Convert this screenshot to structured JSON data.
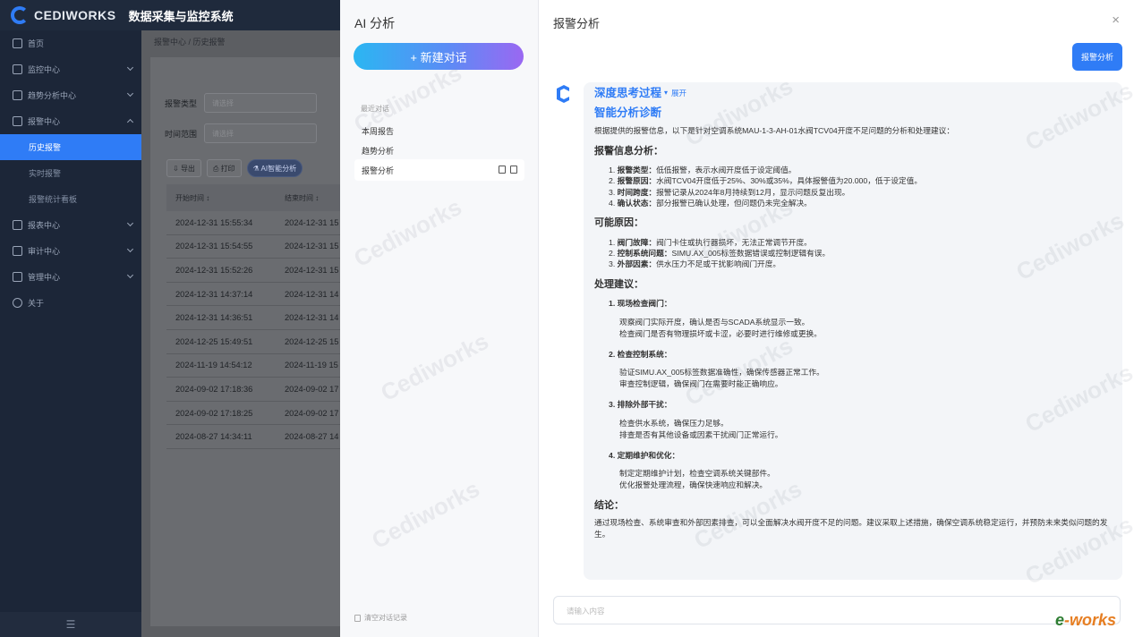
{
  "app": {
    "logo": "CEDIWORKS",
    "system_title": "数据采集与监控系统"
  },
  "sidebar": {
    "items": [
      {
        "label": "首页",
        "has_children": false
      },
      {
        "label": "监控中心",
        "has_children": true
      },
      {
        "label": "趋势分析中心",
        "has_children": true
      },
      {
        "label": "报警中心",
        "has_children": true,
        "expanded": true
      }
    ],
    "sub_items": [
      "历史报警",
      "实时报警",
      "报警统计看板"
    ],
    "active_sub": "历史报警",
    "items_after": [
      "报表中心",
      "审计中心",
      "管理中心",
      "关于"
    ],
    "footer_icon": "☰"
  },
  "main": {
    "breadcrumb": "报警中心 / 历史报警",
    "filters": [
      {
        "label": "报警类型",
        "placeholder": "请选择"
      },
      {
        "label": "时间范围",
        "placeholder": "请选择"
      }
    ],
    "buttons": {
      "export": "导出",
      "print": "打印",
      "ai": "AI智能分析"
    },
    "columns": [
      "开始时间 ↕",
      "结束时间 ↕"
    ],
    "rows": [
      [
        "2024-12-31 15:55:34",
        "2024-12-31 15"
      ],
      [
        "2024-12-31 15:54:55",
        "2024-12-31 15"
      ],
      [
        "2024-12-31 15:52:26",
        "2024-12-31 15"
      ],
      [
        "2024-12-31 14:37:14",
        "2024-12-31 14"
      ],
      [
        "2024-12-31 14:36:51",
        "2024-12-31 14"
      ],
      [
        "2024-12-25 15:49:51",
        "2024-12-25 15"
      ],
      [
        "2024-11-19 14:54:12",
        "2024-11-19 15"
      ],
      [
        "2024-09-02 17:18:36",
        "2024-09-02 17"
      ],
      [
        "2024-09-02 17:18:25",
        "2024-09-02 17"
      ],
      [
        "2024-08-27 14:34:11",
        "2024-08-27 14"
      ]
    ]
  },
  "chat_list": {
    "title": "AI 分析",
    "new_chat": "+ 新建对话",
    "recent_label": "最近对话",
    "items": [
      "本周报告",
      "趋势分析",
      "报警分析"
    ],
    "active_item": "报警分析",
    "clear": "清空对话记录"
  },
  "chat": {
    "title": "报警分析",
    "close": "×",
    "user_message": "报警分析",
    "think_title": "深度思考过程",
    "think_expand": "展开",
    "heading": "智能分析诊断",
    "intro": "根据提供的报警信息，以下是针对空调系统MAU-1-3-AH-01水阀TCV04开度不足问题的分析和处理建议：",
    "sections": [
      {
        "title": "报警信息分析：",
        "items": [
          {
            "n": "1.",
            "k": "报警类型：",
            "v": "低低报警，表示水阀开度低于设定阈值。"
          },
          {
            "n": "2.",
            "k": "报警原因：",
            "v": "水阀TCV04开度低于25%、30%或35%，具体报警值为20.000，低于设定值。"
          },
          {
            "n": "3.",
            "k": "时间跨度：",
            "v": "报警记录从2024年8月持续到12月，显示问题反复出现。"
          },
          {
            "n": "4.",
            "k": "确认状态：",
            "v": "部分报警已确认处理，但问题仍未完全解决。"
          }
        ]
      },
      {
        "title": "可能原因：",
        "items": [
          {
            "n": "1.",
            "k": "阀门故障：",
            "v": "阀门卡住或执行器损坏，无法正常调节开度。"
          },
          {
            "n": "2.",
            "k": "控制系统问题：",
            "v": "SIMU.AX_005标签数据错误或控制逻辑有误。"
          },
          {
            "n": "3.",
            "k": "外部因素：",
            "v": "供水压力不足或干扰影响阀门开度。"
          }
        ]
      }
    ],
    "suggest_title": "处理建议：",
    "suggestions": [
      {
        "h": "1. 现场检查阀门：",
        "lines": [
          "观察阀门实际开度，确认是否与SCADA系统显示一致。",
          "检查阀门是否有物理损坏或卡涩，必要时进行维修或更换。"
        ]
      },
      {
        "h": "2. 检查控制系统：",
        "lines": [
          "验证SIMU.AX_005标签数据准确性，确保传感器正常工作。",
          "审查控制逻辑，确保阀门在需要时能正确响应。"
        ]
      },
      {
        "h": "3. 排除外部干扰：",
        "lines": [
          "检查供水系统，确保压力足够。",
          "排查是否有其他设备或因素干扰阀门正常运行。"
        ]
      },
      {
        "h": "4. 定期维护和优化：",
        "lines": [
          "制定定期维护计划，检查空调系统关键部件。",
          "优化报警处理流程，确保快速响应和解决。"
        ]
      }
    ],
    "conclusion_title": "结论：",
    "conclusion": "通过现场检查、系统审查和外部因素排查，可以全面解决水阀开度不足的问题。建议采取上述措施，确保空调系统稳定运行，并预防未来类似问题的发生。",
    "input_placeholder": "请输入内容"
  },
  "watermark": "Cediworks",
  "brand_mark": {
    "e": "e",
    "rest": "-works"
  }
}
